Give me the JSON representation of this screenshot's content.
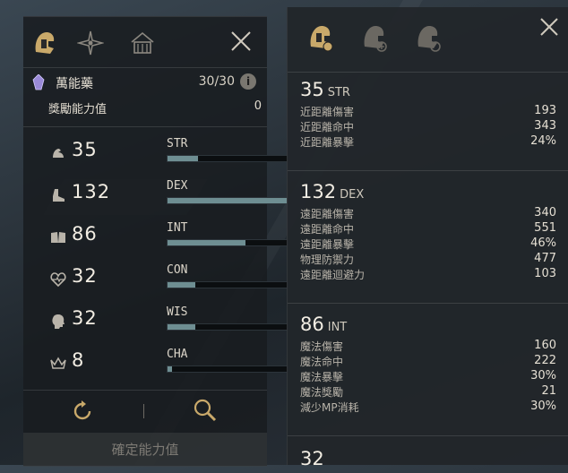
{
  "left": {
    "potion": {
      "name": "萬能藥",
      "count": "30/30",
      "info_glyph": "i"
    },
    "bonus": {
      "label": "獎勵能力值",
      "value": "0"
    },
    "stats": [
      {
        "value": "35",
        "name": "STR",
        "fill": 0.25,
        "icon": "arm-muscle-icon"
      },
      {
        "value": "132",
        "name": "DEX",
        "fill": 1.0,
        "icon": "boot-icon"
      },
      {
        "value": "86",
        "name": "INT",
        "fill": 0.65,
        "icon": "book-icon"
      },
      {
        "value": "32",
        "name": "CON",
        "fill": 0.23,
        "icon": "heart-pulse-icon"
      },
      {
        "value": "32",
        "name": "WIS",
        "fill": 0.23,
        "icon": "head-profile-icon"
      },
      {
        "value": "8",
        "name": "CHA",
        "fill": 0.04,
        "icon": "crown-icon"
      }
    ],
    "confirm_label": "確定能力值"
  },
  "right": {
    "blocks": [
      {
        "value": "35",
        "abbr": "STR",
        "rows": [
          {
            "label": "近距離傷害",
            "value": "193"
          },
          {
            "label": "近距離命中",
            "value": "343"
          },
          {
            "label": "近距離暴擊",
            "value": "24%"
          }
        ]
      },
      {
        "value": "132",
        "abbr": "DEX",
        "rows": [
          {
            "label": "遠距離傷害",
            "value": "340"
          },
          {
            "label": "遠距離命中",
            "value": "551"
          },
          {
            "label": "遠距離暴擊",
            "value": "46%"
          },
          {
            "label": "物理防禦力",
            "value": "477"
          },
          {
            "label": "遠距離迴避力",
            "value": "103"
          }
        ]
      },
      {
        "value": "86",
        "abbr": "INT",
        "rows": [
          {
            "label": "魔法傷害",
            "value": "160"
          },
          {
            "label": "魔法命中",
            "value": "222"
          },
          {
            "label": "魔法暴擊",
            "value": "30%"
          },
          {
            "label": "魔法獎勵",
            "value": "21"
          },
          {
            "label": "減少MP消耗",
            "value": "30%"
          }
        ]
      },
      {
        "value": "32",
        "abbr": "",
        "rows": []
      }
    ]
  },
  "colors": {
    "accent_gold": "#c9a96a",
    "bar_fill": "#6e8e92",
    "potion_purple": "#9a8ad8"
  }
}
